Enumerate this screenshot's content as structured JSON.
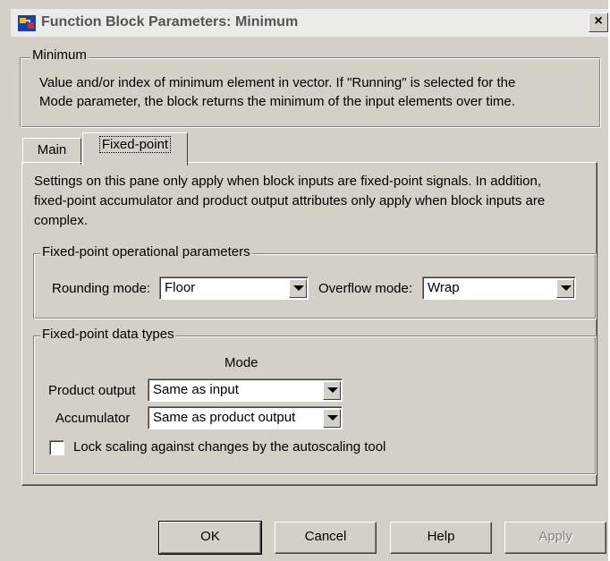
{
  "window": {
    "title": "Function Block Parameters: Minimum",
    "close_glyph": "×"
  },
  "block": {
    "legend": "Minimum",
    "description_line1": "Value and/or index of minimum element in vector. If \"Running\" is selected for the",
    "description_line2": "Mode parameter, the block returns the minimum of the input elements over time."
  },
  "tabs": [
    {
      "label": "Main",
      "active": false
    },
    {
      "label": "Fixed-point",
      "active": true
    }
  ],
  "panel": {
    "note_line1": "Settings on this pane only apply when block inputs are fixed-point signals. In addition,",
    "note_line2": "fixed-point accumulator and product output attributes only apply when block inputs are",
    "note_line3": "complex."
  },
  "operational": {
    "legend": "Fixed-point operational parameters",
    "rounding_label": "Rounding mode:",
    "rounding_value": "Floor",
    "overflow_label": "Overflow mode:",
    "overflow_value": "Wrap"
  },
  "datatypes": {
    "legend": "Fixed-point data types",
    "mode_header": "Mode",
    "product_label": "Product output",
    "product_value": "Same as input",
    "accumulator_label": "Accumulator",
    "accumulator_value": "Same as product output",
    "lock_label": "Lock scaling against changes by the autoscaling tool",
    "lock_checked": false
  },
  "buttons": {
    "ok": "OK",
    "cancel": "Cancel",
    "help": "Help",
    "apply": "Apply"
  },
  "colors": {
    "dialog_bg": "#d4d0c8",
    "title_bg": "#ecebe9",
    "disabled_text": "#808080"
  }
}
